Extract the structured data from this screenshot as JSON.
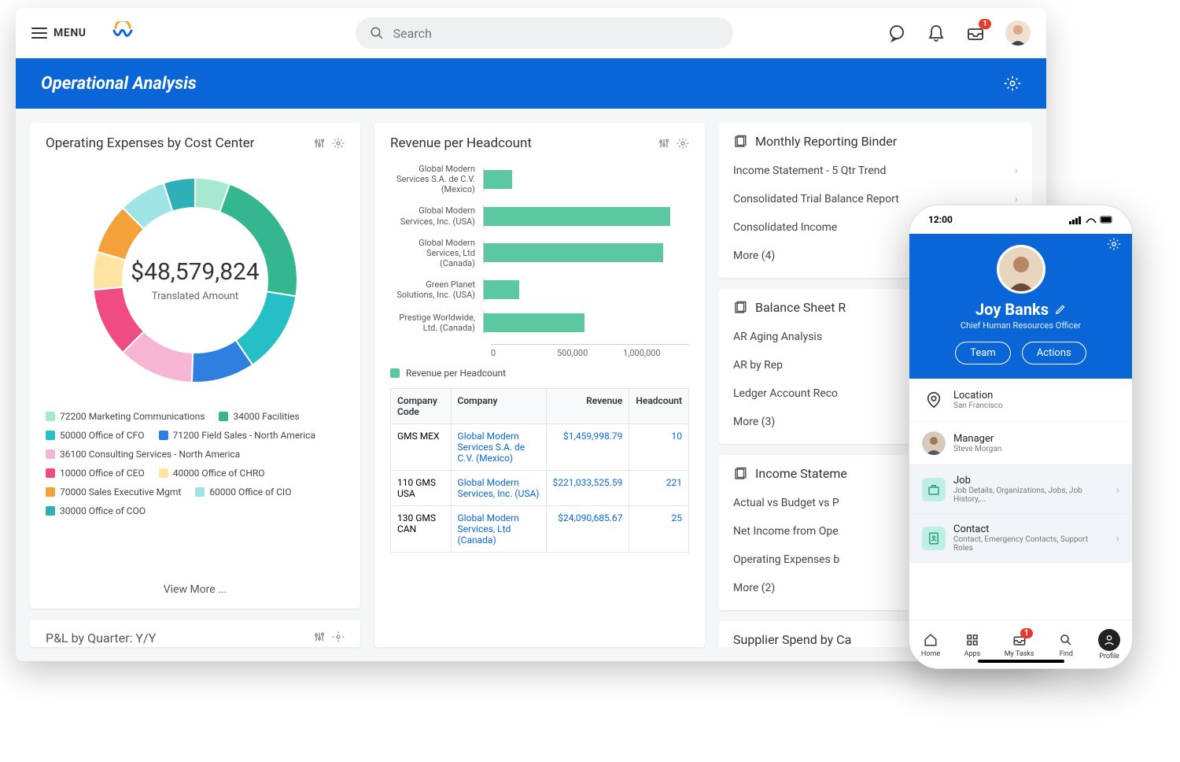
{
  "header": {
    "menu_label": "MENU",
    "search_placeholder": "Search",
    "inbox_badge": "1"
  },
  "banner": {
    "title": "Operational Analysis"
  },
  "donut_card": {
    "title": "Operating Expenses by Cost Center",
    "center_amount": "$48,579,824",
    "center_sub": "Translated Amount",
    "view_more": "View More ..."
  },
  "pnl_stub": {
    "title": "P&L by Quarter: Y/Y"
  },
  "chart_data": {
    "donut": {
      "type": "pie",
      "title": "Operating Expenses by Cost Center",
      "total": 48579824,
      "series": [
        {
          "name": "72200 Marketing Communications",
          "value": 5.5,
          "color": "#a7e8d0"
        },
        {
          "name": "34000 Facilities",
          "value": 22,
          "color": "#34b78f"
        },
        {
          "name": "50000 Office of CFO",
          "value": 13,
          "color": "#26bfc7"
        },
        {
          "name": "71200 Field Sales - North America",
          "value": 10,
          "color": "#2f7fe0"
        },
        {
          "name": "36100 Consulting Services - North America",
          "value": 12,
          "color": "#f6b6d3"
        },
        {
          "name": "10000 Office of CEO",
          "value": 11,
          "color": "#ef4c84"
        },
        {
          "name": "40000 Office of CHRO",
          "value": 6,
          "color": "#ffe4a3"
        },
        {
          "name": "70000 Sales Executive Mgmt",
          "value": 8,
          "color": "#f3a13a"
        },
        {
          "name": "60000 Office of CIO",
          "value": 7.5,
          "color": "#9fe3e5"
        },
        {
          "name": "30000 Office of COO",
          "value": 5,
          "color": "#2fb0b6"
        }
      ]
    },
    "bars": {
      "type": "bar",
      "title": "Revenue per Headcount",
      "xlabel": "",
      "ylabel": "",
      "xlim": [
        0,
        1100000
      ],
      "ticks": [
        "0",
        "500,000",
        "1,000,000"
      ],
      "series_name": "Revenue per Headcount",
      "categories": [
        "Global Modern Services S.A. de C.V. (Mexico)",
        "Global Modern Services, Inc. (USA)",
        "Global Modern Services, Ltd (Canada)",
        "Green Planet Solutions, Inc. (USA)",
        "Prestige Worldwide, Ltd. (Canada)"
      ],
      "values": [
        150000,
        1000000,
        960000,
        190000,
        540000
      ]
    }
  },
  "table": {
    "headers": [
      "Company Code",
      "Company",
      "Revenue",
      "Headcount"
    ],
    "rows": [
      {
        "code": "GMS MEX",
        "company": "Global Modern Services S.A. de C.V. (Mexico)",
        "revenue": "$1,459,998.79",
        "headcount": "10"
      },
      {
        "code": "110 GMS USA",
        "company": "Global Modern Services, Inc. (USA)",
        "revenue": "$221,033,525.59",
        "headcount": "221",
        "extra": "$"
      },
      {
        "code": "130 GMS CAN",
        "company": "Global Modern Services, Ltd (Canada)",
        "revenue": "$24,090,685.67",
        "headcount": "25"
      }
    ]
  },
  "reports": {
    "binder_title": "Monthly Reporting Binder",
    "binder_items": [
      "Income Statement - 5 Qtr Trend",
      "Consolidated Trial Balance Report",
      "Consolidated Income"
    ],
    "binder_more": "More (4)",
    "balance_title": "Balance Sheet R",
    "balance_items": [
      "AR Aging Analysis",
      "AR by Rep",
      "Ledger Account Reco"
    ],
    "balance_more": "More (3)",
    "income_title": "Income Stateme",
    "income_items": [
      "Actual vs Budget vs P",
      "Net Income from Ope",
      "Operating Expenses b"
    ],
    "income_more": "More (2)",
    "supplier_title": "Supplier Spend by Ca"
  },
  "mobile": {
    "time": "12:00",
    "name": "Joy Banks",
    "role": "Chief Human Resources Officer",
    "btn_team": "Team",
    "btn_actions": "Actions",
    "location_label": "Location",
    "location_value": "San Francisco",
    "manager_label": "Manager",
    "manager_value": "Steve Morgan",
    "job_label": "Job",
    "job_sub": "Job Details, Organizations, Jobs, Job History,...",
    "contact_label": "Contact",
    "contact_sub": "Contact, Emergency Contacts, Support Roles",
    "tabs": [
      "Home",
      "Apps",
      "My Tasks",
      "Find",
      "Profile"
    ],
    "tasks_badge": "1"
  }
}
